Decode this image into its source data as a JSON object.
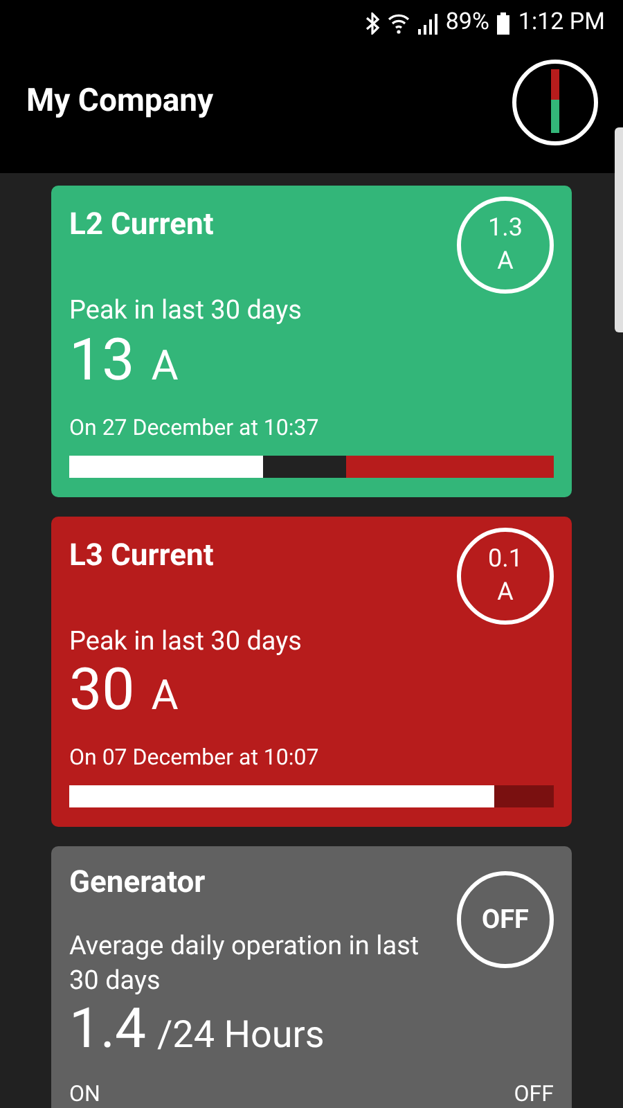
{
  "status_bar": {
    "battery": "89%",
    "time": "1:12 PM"
  },
  "app_bar": {
    "title": "My Company"
  },
  "cards": [
    {
      "kind": "peak",
      "color": "#33b679",
      "title": "L2 Current",
      "badge": [
        "1.3",
        "A"
      ],
      "caption": "Peak in last 30 days",
      "value": "13",
      "unit": "A",
      "when": "On 27 December at 10:37",
      "bar": {
        "color": "#b71c1c",
        "level": 0.4,
        "band": {
          "color": "#222222",
          "level": 0.57
        }
      }
    },
    {
      "kind": "peak",
      "color": "#b71c1c",
      "title": "L3 Current",
      "badge": [
        "0.1",
        "A"
      ],
      "caption": "Peak in last 30 days",
      "value": "30",
      "unit": "A",
      "when": "On 07 December at 10:07",
      "bar": {
        "color": "#7a1010",
        "level": 0.877
      }
    },
    {
      "kind": "runtime",
      "color": "#616161",
      "title": "Generator",
      "badge": [
        "OFF"
      ],
      "caption": "Average daily operation in last 30 days",
      "value": "1.4",
      "unit": "/24 Hours",
      "scale": [
        "ON",
        "OFF"
      ]
    }
  ]
}
